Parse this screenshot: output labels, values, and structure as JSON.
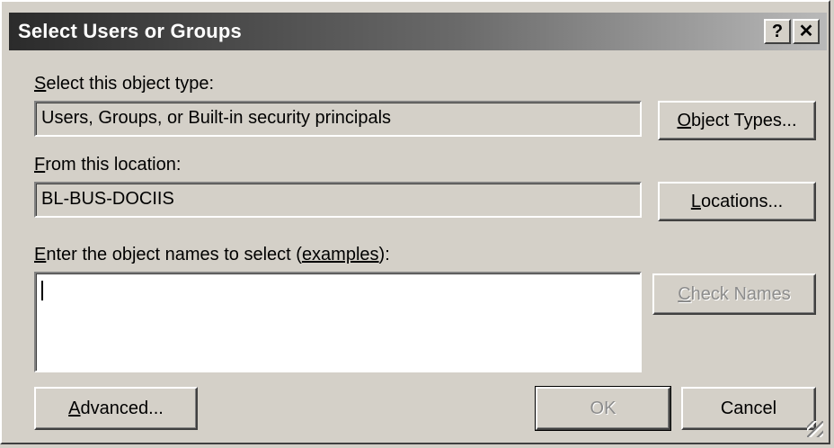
{
  "dialog": {
    "title": "Select Users or Groups",
    "help_glyph": "?",
    "close_glyph": "✕"
  },
  "object_type": {
    "label_mnemonic": "S",
    "label_rest": "elect this object type:",
    "value": "Users, Groups, or Built-in security principals",
    "button_mnemonic": "O",
    "button_rest": "bject Types..."
  },
  "location": {
    "label_mnemonic": "F",
    "label_rest": "rom this location:",
    "value": "BL-BUS-DOCIIS",
    "button_mnemonic": "L",
    "button_rest": "ocations..."
  },
  "names": {
    "label_mnemonic": "E",
    "label_mid": "nter the object names to select (",
    "examples_link": "examples",
    "label_end": "):",
    "value": "",
    "check_button_mnemonic": "C",
    "check_button_rest": "heck Names"
  },
  "footer": {
    "advanced_mnemonic": "A",
    "advanced_rest": "dvanced...",
    "ok_label": "OK",
    "cancel_label": "Cancel"
  }
}
